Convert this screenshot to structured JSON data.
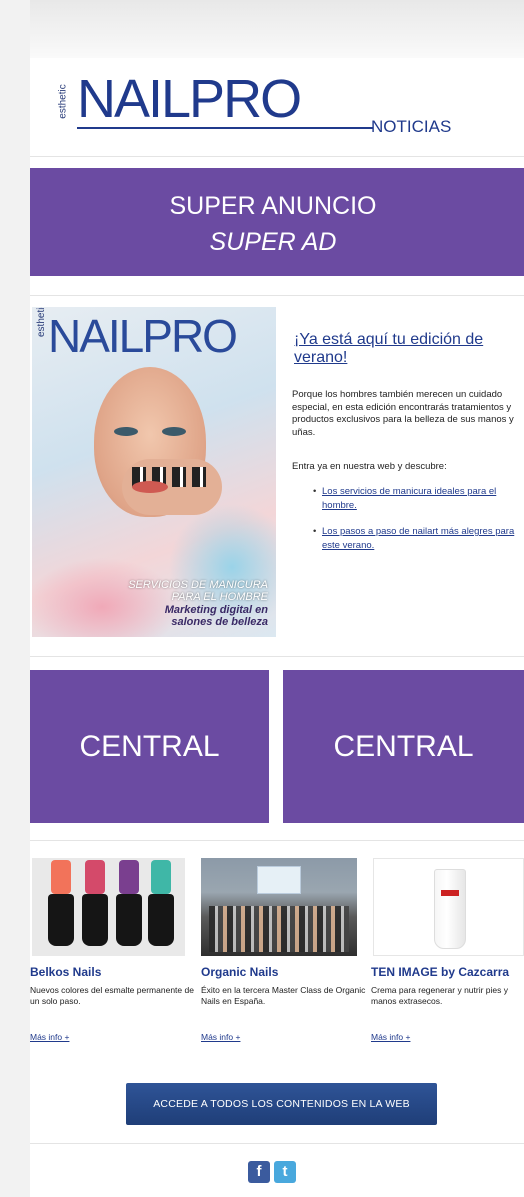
{
  "header": {
    "logo_small": "esthetic",
    "logo_main": "NAILPRO",
    "logo_section": "NOTICIAS"
  },
  "super_ad": {
    "line1": "SUPER ANUNCIO",
    "line2": "SUPER AD"
  },
  "feature": {
    "cover": {
      "small": "esthetic",
      "logo": "NAILPRO",
      "line1": "SERVICIOS DE MANICURA",
      "line2": "PARA EL HOMBRE",
      "line3": "Marketing digital en",
      "line4": "salones de belleza"
    },
    "title": "¡Ya está aquí tu edición de verano!",
    "paragraph": "Porque los hombres también merecen un cuidado especial, en esta edición encontrarás tratamientos y productos exclusivos para la belleza de sus manos y uñas.",
    "intro": "Entra ya en nuestra web y descubre:",
    "links": [
      "Los servicios de manicura ideales para el hombre.",
      "Los pasos a paso de nailart más alegres para este verano."
    ]
  },
  "central_ads": [
    "CENTRAL",
    "CENTRAL"
  ],
  "products": [
    {
      "title": "Belkos Nails",
      "desc": "Nuevos colores del esmalte permanente de un solo paso.",
      "more": "Más info +"
    },
    {
      "title": "Organic Nails",
      "desc": "Éxito en la tercera Master Class de Organic Nails en España.",
      "more": "Más info +"
    },
    {
      "title": "TEN IMAGE by Cazcarra",
      "desc": "Crema para regenerar y nutrir pies y manos extrasecos.",
      "more": "Más info +"
    }
  ],
  "cta_label": "ACCEDE A TODOS LOS CONTENIDOS EN LA WEB",
  "social": {
    "facebook": "f",
    "twitter": "t"
  },
  "colors": {
    "brand_blue": "#203a8c",
    "ad_purple": "#6b4ba2",
    "cta_blue": "#2f5497"
  }
}
